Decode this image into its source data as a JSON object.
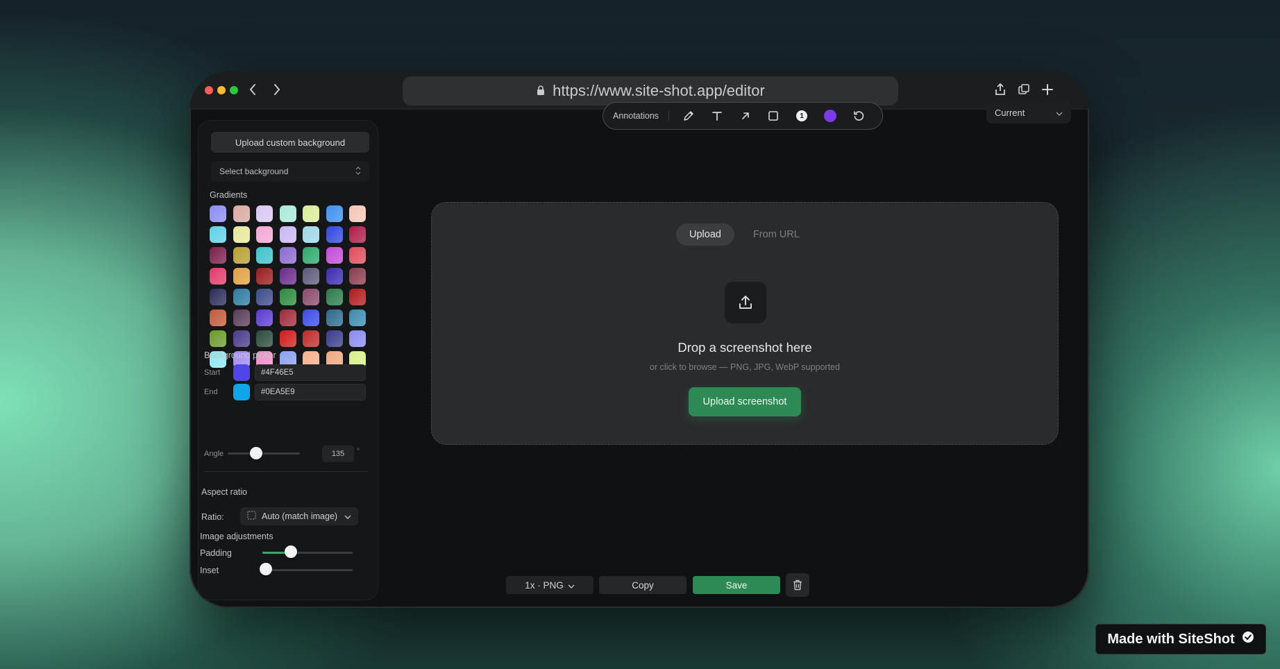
{
  "browser": {
    "url": "https://www.site-shot.app/editor"
  },
  "sidebar": {
    "upload_bg_label": "Upload custom background",
    "select_bg_placeholder": "Select background",
    "gradients_title": "Gradients",
    "gradients": [
      [
        "#8a8cf5",
        "#d8a9a0",
        "#d9c6f2",
        "#a8ead8",
        "#d9ec9a",
        "#3d8ff0",
        "#f4c6b6"
      ],
      [
        "#5fd1e6",
        "#e6e89a",
        "#f3a6d2",
        "#c8b8f2",
        "#9fd6e6",
        "#2f47e0",
        "#b01a48"
      ],
      [
        "#7a1f4a",
        "#b6a030",
        "#3ec1c9",
        "#8a6ad0",
        "#2aa86a",
        "#c24ad8",
        "#e04a5a"
      ],
      [
        "#e03a6a",
        "#e0a040",
        "#9a1a1a",
        "#6a2a8a",
        "#5a5a7a",
        "#3a2ab0",
        "#8a3a4a"
      ],
      [
        "#2a2a5a",
        "#2a7aa0",
        "#3a4a8a",
        "#2a8a3a",
        "#8a4a6a",
        "#2a7a4a",
        "#b01a1a"
      ],
      [
        "#c05a3a",
        "#5a3a5a",
        "#5a3ad0",
        "#a02a3a",
        "#3a4ae8",
        "#2a6a8a",
        "#3a8ab0"
      ],
      [
        "#6a9a2a",
        "#4a3a8a",
        "#2a4a3a",
        "#d01a1a",
        "#c02a2a",
        "#3a3a8a",
        "#8a8af0"
      ],
      [
        "#8ae8f0",
        "#a08af0",
        "#f08ac8",
        "#8aa0f0",
        "#f8b08a",
        "#f0a880",
        "#d8f08a"
      ]
    ],
    "picker_title": "Background picker",
    "start_label": "Start",
    "start_color": "#4F46E5",
    "end_label": "End",
    "end_color": "#0EA5E9",
    "angle_label": "Angle",
    "angle_value": "135",
    "angle_unit": "°",
    "aspect_title": "Aspect ratio",
    "ratio_label": "Ratio:",
    "ratio_value": "Auto (match image)",
    "adjust_title": "Image adjustments",
    "padding_label": "Padding",
    "inset_label": "Inset"
  },
  "toolbar": {
    "annotations_label": "Annotations",
    "active_color": "#7c3aed",
    "number_badge": "1",
    "current_label": "Current"
  },
  "dropzone": {
    "tab_upload": "Upload",
    "tab_url": "From URL",
    "title": "Drop a screenshot here",
    "subtitle": "or click to browse — PNG, JPG, WebP supported",
    "upload_button": "Upload screenshot"
  },
  "export": {
    "format_label": "1x · PNG",
    "copy_label": "Copy",
    "save_label": "Save"
  },
  "badge": {
    "text": "Made with SiteShot"
  }
}
